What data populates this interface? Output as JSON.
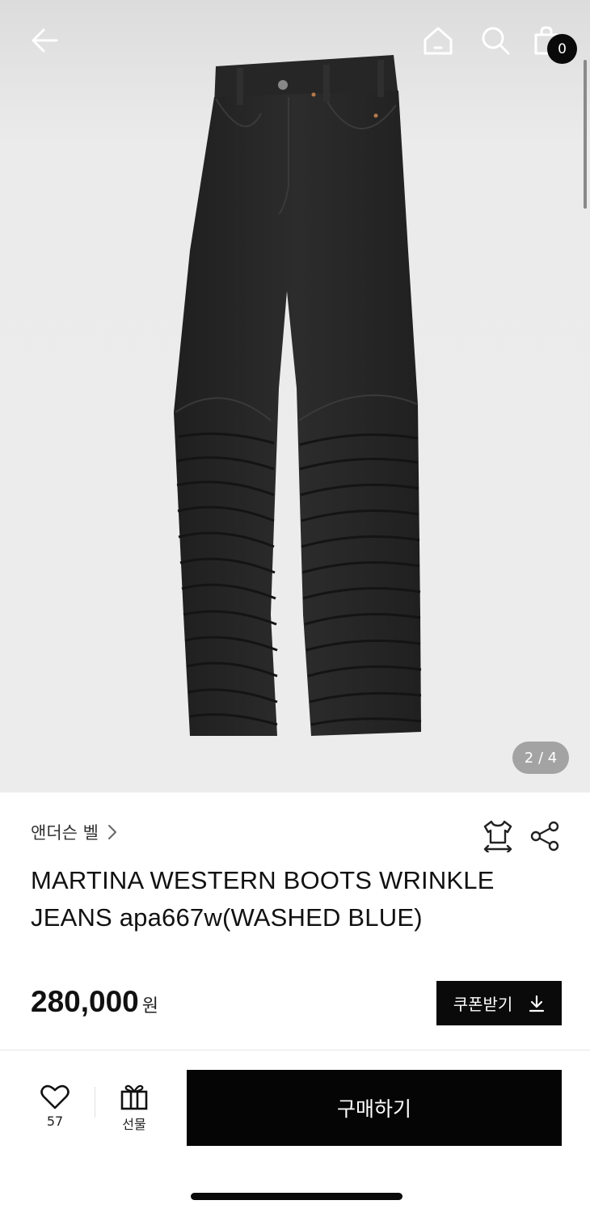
{
  "header": {
    "icons": [
      "back-arrow-icon",
      "home-icon",
      "search-icon",
      "shopping-bag-icon"
    ],
    "cart_count": "0"
  },
  "gallery": {
    "current_page": "2",
    "total_pages": "4",
    "indicator_text": "2 / 4",
    "image_subject": "jeans"
  },
  "product": {
    "brand": "앤더슨 벨",
    "title_line1": "MARTINA WESTERN BOOTS WRINKLE",
    "title_line2": "JEANS apa667w(WASHED BLUE)",
    "price": "280,000",
    "price_unit": "원",
    "coupon_label": "쿠폰받기"
  },
  "bottom_bar": {
    "like_count": "57",
    "gift_label": "선물",
    "buy_label": "구매하기"
  },
  "colors": {
    "accent": "#0a0a0a",
    "hero_bg": "#ececec",
    "page_indicator_bg": "#969696"
  }
}
